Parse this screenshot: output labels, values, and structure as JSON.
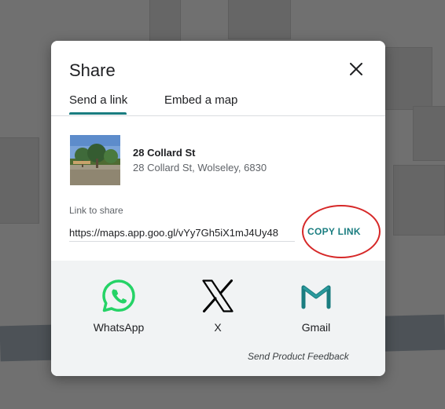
{
  "dialog": {
    "title": "Share",
    "tabs": [
      {
        "label": "Send a link",
        "active": true
      },
      {
        "label": "Embed a map",
        "active": false
      }
    ]
  },
  "place": {
    "name": "28 Collard St",
    "address": "28 Collard St, Wolseley, 6830"
  },
  "link": {
    "label": "Link to share",
    "url": "https://maps.app.goo.gl/vYy7Gh5iX1mJ4Uy48",
    "copy_label": "COPY LINK"
  },
  "share_targets": [
    {
      "label": "WhatsApp",
      "icon": "whatsapp-icon",
      "color": "#25D366"
    },
    {
      "label": "X",
      "icon": "x-icon",
      "color": "#000000"
    },
    {
      "label": "Gmail",
      "icon": "gmail-icon",
      "color": "#1a7d80"
    }
  ],
  "feedback_label": "Send Product Feedback",
  "colors": {
    "accent": "#1a7d80",
    "highlight": "#d62828"
  }
}
